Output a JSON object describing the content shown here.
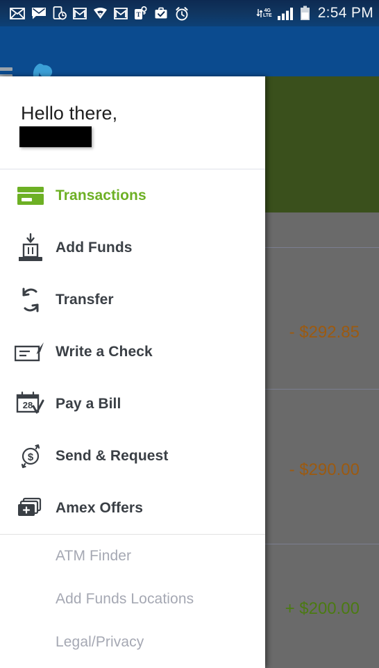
{
  "status_bar": {
    "icons": [
      {
        "name": "email-envelope-icon",
        "label": "Email"
      },
      {
        "name": "message-envelope-icon",
        "label": "Message"
      },
      {
        "name": "phone-clock-icon",
        "label": "Scheduled call"
      },
      {
        "name": "gmail-icon",
        "label": "Gmail"
      },
      {
        "name": "wifi-calling-icon",
        "label": "Wi-Fi calling"
      },
      {
        "name": "gmail-secondary-icon",
        "label": "Gmail"
      },
      {
        "name": "tmobile-keytag-icon",
        "label": "T-Mobile"
      },
      {
        "name": "briefcase-check-icon",
        "label": "Work profile"
      },
      {
        "name": "alarm-clock-icon",
        "label": "Alarm"
      }
    ],
    "network_label_top": "4G",
    "network_label_mid": "LTE",
    "signal_name": "signal-bars-icon",
    "battery_name": "battery-icon",
    "time": "2:54 PM"
  },
  "app_header": {
    "menu_button_name": "hamburger-menu-button",
    "logo_name": "bluebird-logo",
    "logo_colors": {
      "bird": "#3b9fd6",
      "wing": "#a4c93a"
    },
    "background": "#0b4b8f"
  },
  "drawer": {
    "greeting": "Hello there,",
    "username": "",
    "username_redacted": true,
    "primary_items": [
      {
        "label": "Transactions",
        "icon": "credit-card-icon",
        "active": true
      },
      {
        "label": "Add Funds",
        "icon": "add-funds-deposit-icon",
        "active": false
      },
      {
        "label": "Transfer",
        "icon": "transfer-arrows-icon",
        "active": false
      },
      {
        "label": "Write a Check",
        "icon": "check-pen-icon",
        "active": false
      },
      {
        "label": "Pay a Bill",
        "icon": "calendar-check-icon",
        "calendar_day": "28",
        "active": false
      },
      {
        "label": "Send & Request",
        "icon": "send-request-dollar-icon",
        "active": false
      },
      {
        "label": "Amex Offers",
        "icon": "stacked-cards-plus-icon",
        "active": false
      }
    ],
    "secondary_items": [
      {
        "label": "ATM Finder"
      },
      {
        "label": "Add Funds Locations"
      },
      {
        "label": "Legal/Privacy"
      }
    ],
    "active_color": "#6db024",
    "label_color": "#3a3f45",
    "secondary_color": "#a5a8b3"
  },
  "background_content": {
    "balance_card_color": "#3a501c",
    "overlay_color": "#6a6a6a",
    "transactions": [
      {
        "amount": "- $292.85",
        "type": "debit"
      },
      {
        "amount": "- $290.00",
        "type": "debit"
      },
      {
        "amount": "+ $200.00",
        "type": "credit"
      }
    ],
    "debit_color": "#9c5a10",
    "credit_color": "#4b7a12"
  }
}
